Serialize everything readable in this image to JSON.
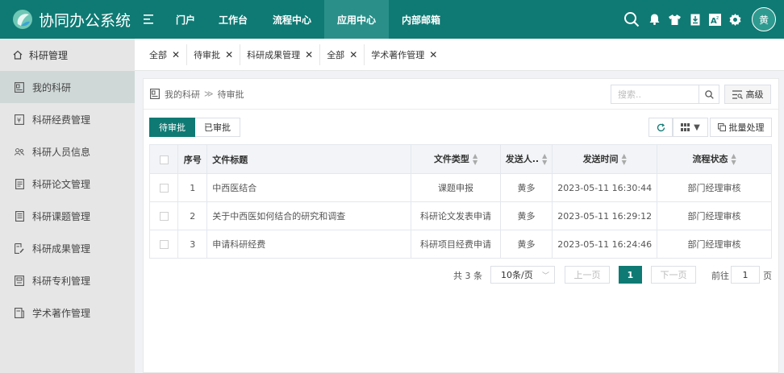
{
  "app": {
    "title": "协同办公系统",
    "menu_icon": "hamburger-icon"
  },
  "nav": [
    {
      "label": "门户",
      "active": false
    },
    {
      "label": "工作台",
      "active": false
    },
    {
      "label": "流程中心",
      "active": false
    },
    {
      "label": "应用中心",
      "active": true
    },
    {
      "label": "内部邮箱",
      "active": false
    }
  ],
  "header_tools": [
    "search-icon",
    "bell-icon",
    "shirt-icon",
    "download-icon",
    "font-size-icon",
    "gear-icon"
  ],
  "user": {
    "avatar_text": "黄"
  },
  "sidebar": {
    "title": "科研管理",
    "items": [
      {
        "label": "我的科研",
        "active": true
      },
      {
        "label": "科研经费管理",
        "active": false
      },
      {
        "label": "科研人员信息",
        "active": false
      },
      {
        "label": "科研论文管理",
        "active": false
      },
      {
        "label": "科研课题管理",
        "active": false
      },
      {
        "label": "科研成果管理",
        "active": false
      },
      {
        "label": "科研专利管理",
        "active": false
      },
      {
        "label": "学术著作管理",
        "active": false
      }
    ]
  },
  "tabs": [
    {
      "label": "全部"
    },
    {
      "label": "待审批"
    },
    {
      "label": "科研成果管理"
    },
    {
      "label": "全部"
    },
    {
      "label": "学术著作管理"
    }
  ],
  "breadcrumb": {
    "root": "我的科研",
    "separator": "≫",
    "current": "待审批"
  },
  "search": {
    "placeholder": "搜索..",
    "advanced_label": "高级"
  },
  "filters": {
    "pending": "待审批",
    "approved": "已审批"
  },
  "toolbar": {
    "batch_label": "批量处理"
  },
  "table": {
    "headers": {
      "no": "序号",
      "title": "文件标题",
      "type": "文件类型",
      "sender": "发送人..",
      "time": "发送时间",
      "status": "流程状态"
    },
    "rows": [
      {
        "no": "1",
        "title": "中西医结合",
        "type": "课题申报",
        "sender": "黄多",
        "time": "2023-05-11 16:30:44",
        "status": "部门经理审核"
      },
      {
        "no": "2",
        "title": "关于中西医如何结合的研究和调查",
        "type": "科研论文发表申请",
        "sender": "黄多",
        "time": "2023-05-11 16:29:12",
        "status": "部门经理审核"
      },
      {
        "no": "3",
        "title": "申请科研经费",
        "type": "科研项目经费申请",
        "sender": "黄多",
        "time": "2023-05-11 16:24:46",
        "status": "部门经理审核"
      }
    ]
  },
  "pagination": {
    "total": "共 3 条",
    "page_size": "10条/页",
    "prev": "上一页",
    "current": "1",
    "next": "下一页",
    "goto_label": "前往",
    "goto_value": "1",
    "goto_unit": "页"
  },
  "colors": {
    "primary": "#0f7a74",
    "nav_active": "#2a8f89",
    "sidebar_bg": "#e6e6e6",
    "sidebar_active": "#cfd8d7"
  }
}
